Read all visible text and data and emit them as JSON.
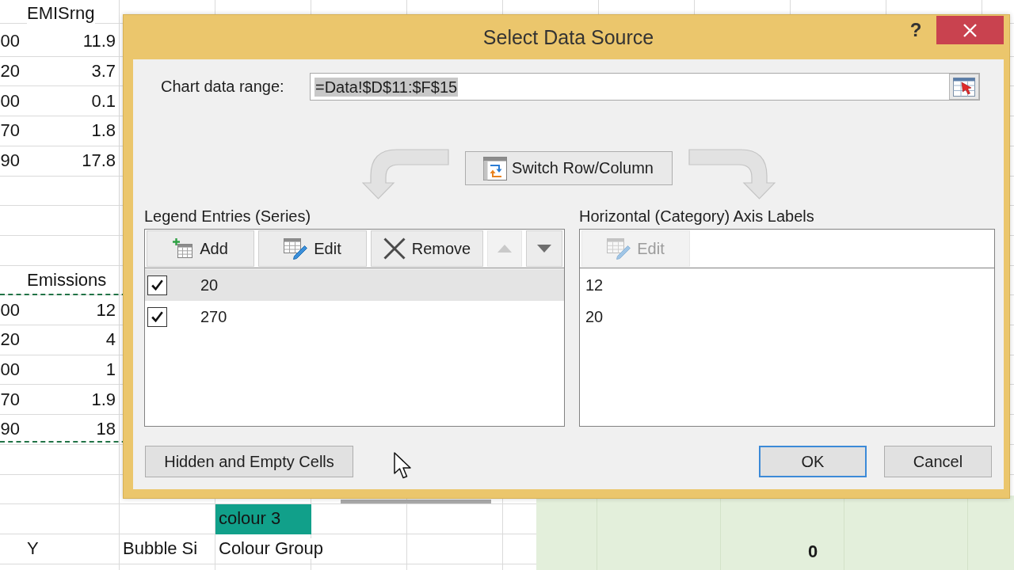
{
  "spreadsheet": {
    "copy_marquee": true,
    "rows": [
      {
        "column_2": {
          "text": "EMISrng",
          "kind": "label"
        }
      },
      {
        "column_1": {
          "text": "00",
          "kind": "number"
        },
        "column_2": {
          "text": "11.9",
          "kind": "number"
        }
      },
      {
        "column_1": {
          "text": "20",
          "kind": "number"
        },
        "column_2": {
          "text": "3.7",
          "kind": "number"
        }
      },
      {
        "column_1": {
          "text": "00",
          "kind": "number"
        },
        "column_2": {
          "text": "0.1",
          "kind": "number"
        }
      },
      {
        "column_1": {
          "text": "70",
          "kind": "number"
        },
        "column_2": {
          "text": "1.8",
          "kind": "number"
        }
      },
      {
        "column_1": {
          "text": "90",
          "kind": "number"
        },
        "column_2": {
          "text": "17.8",
          "kind": "number"
        }
      },
      {},
      {},
      {},
      {
        "column_2": {
          "text": "Emissions",
          "kind": "label"
        }
      },
      {
        "column_1": {
          "text": "00",
          "kind": "number"
        },
        "column_2": {
          "text": "12",
          "kind": "number"
        }
      },
      {
        "column_1": {
          "text": "20",
          "kind": "number"
        },
        "column_2": {
          "text": "4",
          "kind": "number"
        }
      },
      {
        "column_1": {
          "text": "00",
          "kind": "number"
        },
        "column_2": {
          "text": "1",
          "kind": "number"
        }
      },
      {
        "column_1": {
          "text": "70",
          "kind": "number"
        },
        "column_2": {
          "text": "1.9",
          "kind": "number"
        }
      },
      {
        "column_1": {
          "text": "90",
          "kind": "number"
        },
        "column_2": {
          "text": "18",
          "kind": "number"
        }
      },
      {},
      {},
      {
        "column_4": {
          "text": "colour 3",
          "kind": "label",
          "color": "#11a08a"
        }
      },
      {
        "column_2": {
          "text": "Y",
          "kind": "label"
        },
        "column_3": {
          "text": "Bubble Si",
          "kind": "label"
        },
        "column_4": {
          "text": "Colour Group",
          "kind": "label"
        }
      }
    ]
  },
  "dialog": {
    "title": "Select Data Source",
    "help_label": "?",
    "data_range": {
      "label": "Chart data range:",
      "value": "=Data!$D$11:$F$15",
      "value_selected": true
    },
    "switch_button": {
      "label": "Switch Row/Column"
    },
    "legend_entries": {
      "label": "Legend Entries (Series)",
      "buttons": [
        {
          "kind": "add",
          "label": "Add",
          "disabled": false
        },
        {
          "kind": "edit",
          "label": "Edit",
          "disabled": false
        },
        {
          "kind": "remove",
          "label": "Remove",
          "disabled": false
        },
        {
          "kind": "move_up",
          "disabled": true
        },
        {
          "kind": "move_down",
          "disabled": false
        }
      ],
      "items": [
        {
          "label": "20",
          "checked": true,
          "selected": true
        },
        {
          "label": "270",
          "checked": true,
          "selected": false
        }
      ]
    },
    "axis_labels": {
      "label": "Horizontal (Category) Axis Labels",
      "buttons": [
        {
          "kind": "edit",
          "label": "Edit",
          "disabled": true
        }
      ],
      "items": [
        {
          "label": "12",
          "selected": false
        },
        {
          "label": "20",
          "selected": false
        }
      ]
    },
    "footer": {
      "hidden_cells_button": {
        "label": "Hidden and Empty Cells"
      },
      "buttons": [
        {
          "label": "OK",
          "default": true
        },
        {
          "label": "Cancel",
          "default": false
        }
      ]
    }
  },
  "chart_object": {
    "axis_label": "0"
  }
}
